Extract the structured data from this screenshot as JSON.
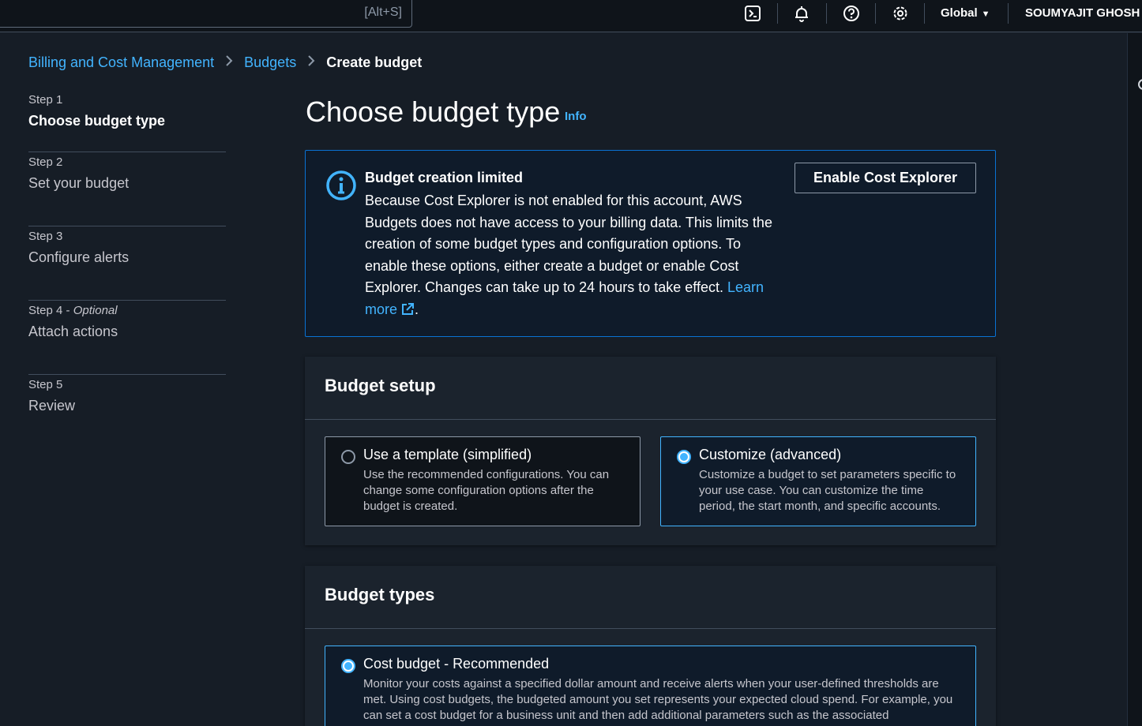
{
  "topnav": {
    "search_shortcut": "[Alt+S]",
    "icons": [
      "cloudshell-icon",
      "bell-icon",
      "help-icon",
      "settings-icon"
    ],
    "region": "Global",
    "user": "SOUMYAJIT GHOSH"
  },
  "breadcrumb": {
    "items": [
      "Billing and Cost Management",
      "Budgets"
    ],
    "current": "Create budget"
  },
  "steps": [
    {
      "num": "Step 1",
      "title": "Choose budget type",
      "active": true
    },
    {
      "num": "Step 2",
      "title": "Set your budget"
    },
    {
      "num": "Step 3",
      "title": "Configure alerts"
    },
    {
      "num": "Step 4",
      "optional": "Optional",
      "title": "Attach actions"
    },
    {
      "num": "Step 5",
      "title": "Review"
    }
  ],
  "page": {
    "title": "Choose budget type",
    "info": "Info"
  },
  "alert": {
    "title": "Budget creation limited",
    "body": "Because Cost Explorer is not enabled for this account, AWS Budgets does not have access to your billing data. This limits the creation of some budget types and configuration options. To enable these options, either create a budget or enable Cost Explorer. Changes can take up to 24 hours to take effect.",
    "learn_more": "Learn more",
    "button": "Enable Cost Explorer"
  },
  "budget_setup": {
    "header": "Budget setup",
    "options": [
      {
        "title": "Use a template (simplified)",
        "desc": "Use the recommended configurations. You can change some configuration options after the budget is created.",
        "selected": false
      },
      {
        "title": "Customize (advanced)",
        "desc": "Customize a budget to set parameters specific to your use case. You can customize the time period, the start month, and specific accounts.",
        "selected": true
      }
    ]
  },
  "budget_types": {
    "header": "Budget types",
    "options": [
      {
        "title": "Cost budget - Recommended",
        "desc": "Monitor your costs against a specified dollar amount and receive alerts when your user-defined thresholds are met. Using cost budgets, the budgeted amount you set represents your expected cloud spend. For example, you can set a cost budget for a business unit and then add additional parameters such as the associated",
        "selected": true
      }
    ]
  },
  "colors": {
    "accent": "#42b4ff",
    "background": "#161d26",
    "alert_border": "#0972d3"
  }
}
